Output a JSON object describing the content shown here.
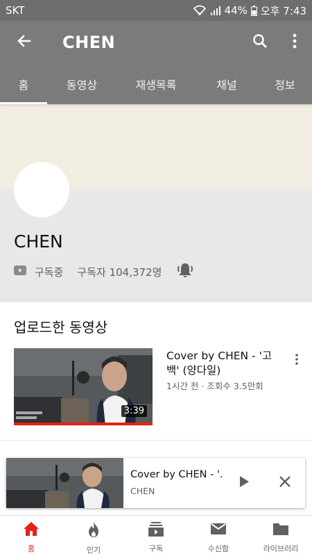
{
  "status_bar": {
    "carrier": "SKT",
    "battery": "44%",
    "time": "오후 7:43"
  },
  "app_bar": {
    "title": "CHEN",
    "icons": [
      "back-arrow-icon",
      "search-icon",
      "more-vert-icon"
    ]
  },
  "tabs": [
    {
      "label": "홈",
      "active": true
    },
    {
      "label": "동영상",
      "active": false
    },
    {
      "label": "재생목록",
      "active": false
    },
    {
      "label": "채널",
      "active": false
    },
    {
      "label": "정보",
      "active": false
    }
  ],
  "channel": {
    "name": "CHEN",
    "subscribed_label": "구독중",
    "subscriber_count": "구독자 104,372명"
  },
  "uploads": {
    "section_title": "업로드한 동영상",
    "video": {
      "title": "Cover by CHEN - '고백' (양다일)",
      "meta": "1시간 전 · 조회수 3.5만회",
      "duration": "3:39"
    }
  },
  "mini_player": {
    "title": "Cover by CHEN - '...",
    "channel": "CHEN"
  },
  "bottom_nav": [
    {
      "label": "홈",
      "icon": "home-icon",
      "active": true
    },
    {
      "label": "인기",
      "icon": "trending-flame-icon",
      "active": false
    },
    {
      "label": "구독",
      "icon": "subscriptions-icon",
      "active": false
    },
    {
      "label": "수신함",
      "icon": "inbox-mail-icon",
      "active": false
    },
    {
      "label": "라이브러리",
      "icon": "library-folder-icon",
      "active": false
    }
  ],
  "colors": {
    "header_gray": "#7b7b7b",
    "status_gray": "#6e6e6e",
    "banner": "#f1ede0",
    "accent_red": "#e62117"
  }
}
